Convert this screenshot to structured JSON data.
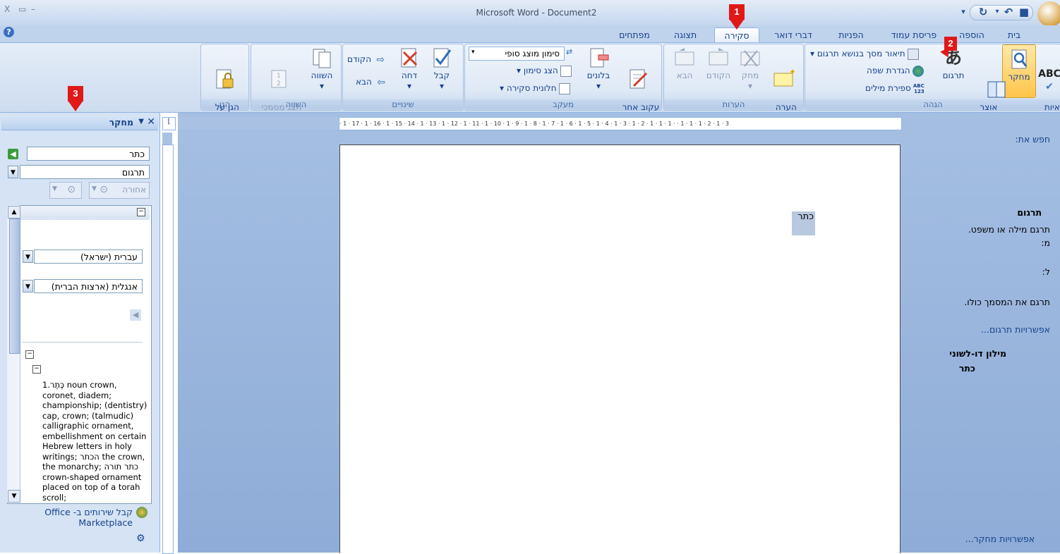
{
  "titlebar": {
    "title": "Microsoft Word - Document2",
    "close": "X",
    "restore": "▭",
    "minimize": "–"
  },
  "tabs": [
    {
      "label": "בית"
    },
    {
      "label": "הוספה"
    },
    {
      "label": "פריסת עמוד"
    },
    {
      "label": "הפניות"
    },
    {
      "label": "דברי דואר"
    },
    {
      "label": "סקירה"
    },
    {
      "label": "תצוגה"
    },
    {
      "label": "מפתחים"
    }
  ],
  "ribbon": {
    "proofing": {
      "label": "הגהה",
      "spelling": "איות\nודקדוק",
      "research": "מחקר",
      "thesaurus": "אוצר\nמילים",
      "translate": "תרגום",
      "tooltip_translate": "תיאור מסך בנושא תרגום",
      "language": "הגדרת שפה",
      "wordcount": "ספירת מילים"
    },
    "comments": {
      "label": "הערות",
      "new": "הערה\nחדשה",
      "delete": "מחק",
      "previous": "הקודם",
      "next": "הבא"
    },
    "tracking": {
      "label": "מעקב",
      "track": "עקוב אחר\nשינויים",
      "balloons": "בלונים",
      "display_value": "סימון מוצג סופי",
      "show_markup": "הצג סימון",
      "reviewing_pane": "חלונית סקירה"
    },
    "changes": {
      "label": "שינויים",
      "accept": "קבל",
      "reject": "דחה",
      "previous": "הקודם",
      "next": "הבא"
    },
    "compare": {
      "label": "השווה",
      "compare": "השווה",
      "show_source": "הצג מסמכי\nמקור"
    },
    "protect": {
      "label": "הגן",
      "protect_doc": "הגן על\nהמסמך"
    }
  },
  "research_pane": {
    "title": "מחקר",
    "search_for_label": "חפש את:",
    "search_value": "כתר",
    "service_value": "תרגום",
    "back_label": "אחורה",
    "translation": {
      "header": "תרגום",
      "hint": "תרגם מילה או משפט.",
      "from_label": "מ:",
      "from_value": "עברית (ישראל)",
      "to_label": "ל:",
      "to_value": "אנגלית (ארצות הברית)",
      "translate_doc": "תרגם את המסמך כולו.",
      "options_link": "אפשרויות תרגום..."
    },
    "dictionary": {
      "header": "מילון דו-לשוני",
      "word": "כתר",
      "definition": "1.כֶּתֶר noun crown, coronet, diadem; championship; (dentistry) cap, crown; (talmudic) calligraphic ornament, embellishment on certain Hebrew letters in holy writings; הכתר the crown, the monarchy; כתר תורה crown-shaped ornament placed on top of a torah scroll;"
    },
    "marketplace_link": "קבל שירותים ב- Office Marketplace",
    "research_options_link": "אפשרויות מחקר..."
  },
  "document": {
    "selected_word": "כתר"
  },
  "ruler": {
    "numbers": "· 1 · 17 · 1 · 16 · 1 · 15 · 14 · 1 · 13 · 1 · 12 · 1 · 11 · 1 · 10 · 1 · 9 · 1 · 8 · 1 · 7 · 1 · 6 · 1 · 5 · 1 · 4 · 1 · 3 · 1 · 2 · 1 · 1 · 1 ·  · 1 · 1 · 1 · 2 · 1 · 3"
  },
  "markers": {
    "m1": "1",
    "m2": "2",
    "m3": "3"
  },
  "colors": {
    "accent": "#15428b",
    "marker": "#e01818",
    "ribbon": "#dfe9f6"
  }
}
